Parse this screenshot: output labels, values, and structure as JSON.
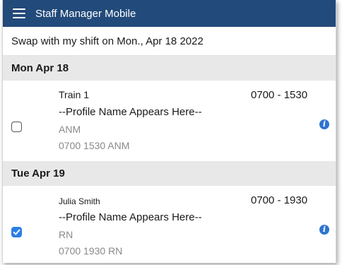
{
  "app": {
    "title": "Staff Manager Mobile",
    "header_color": "#224a7a"
  },
  "swap_request": {
    "label": "Swap with my shift on Mon., Apr 18 2022"
  },
  "days": [
    {
      "header": "Mon Apr 18",
      "shift": {
        "checked": false,
        "name": "Train 1",
        "time": "0700 - 1530",
        "profile": "--Profile Name Appears Here--",
        "role": "ANM",
        "code": "0700 1530 ANM",
        "info_icon": "info-icon"
      }
    },
    {
      "header": "Tue Apr 19",
      "shift": {
        "checked": true,
        "name": "Julia Smith",
        "time": "0700 - 1930",
        "profile": "--Profile Name Appears Here--",
        "role": "RN",
        "code": "0700 1930 RN",
        "info_icon": "info-icon"
      }
    }
  ],
  "colors": {
    "accent": "#2d7ee6",
    "info": "#2f74d0",
    "day_header_bg": "#e8e8e8",
    "muted_text": "#8a8a8a"
  }
}
